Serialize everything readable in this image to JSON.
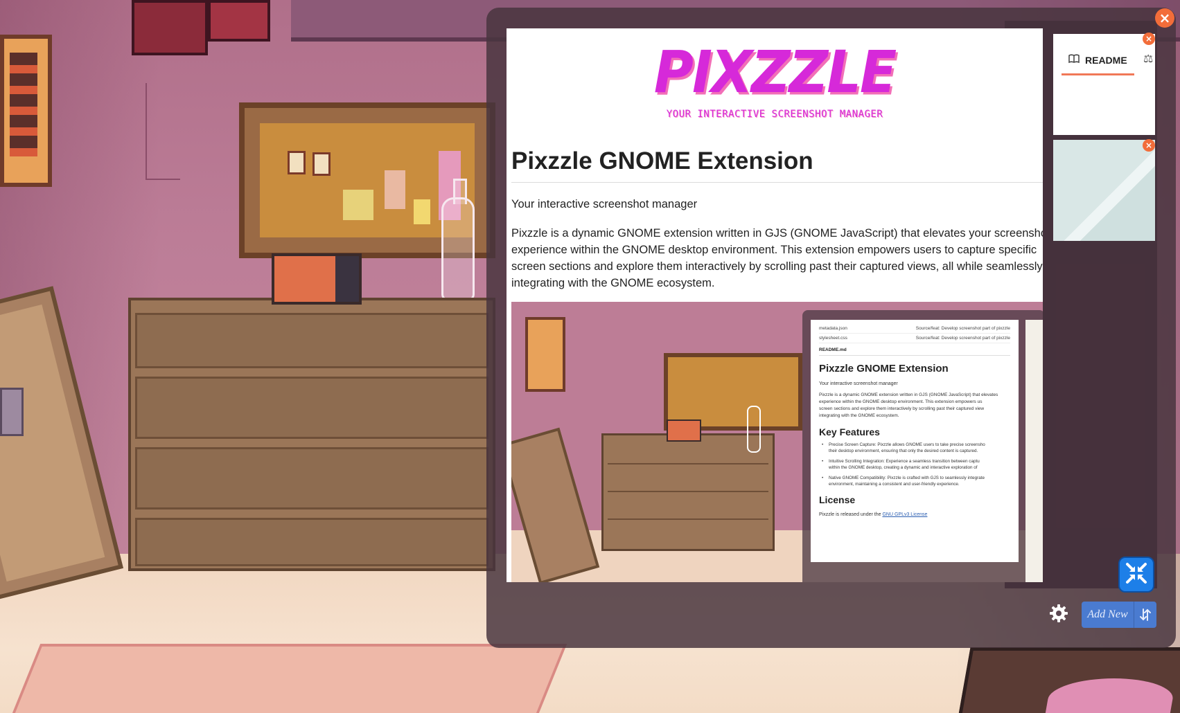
{
  "app": {
    "logo_title": "PIXZZLE",
    "logo_tagline": "YOUR INTERACTIVE SCREENSHOT MANAGER"
  },
  "readme": {
    "heading": "Pixzzle GNOME Extension",
    "subtitle": "Your interactive screenshot manager",
    "paragraph_lines": [
      "Pixzzle is a dynamic GNOME extension written in GJS (GNOME JavaScript) that elevates your screenshot",
      "experience within the GNOME desktop environment. This extension empowers users to capture specific",
      "screen sections and explore them interactively by scrolling past their captured views, all while seamlessly",
      "integrating with the GNOME ecosystem."
    ]
  },
  "nested_screenshot": {
    "files": [
      {
        "name": "metadata.json",
        "commit": "Source/feat: Develop screenshot part of pixzzle"
      },
      {
        "name": "stylesheet.css",
        "commit": "Source/feat: Develop screenshot part of pixzzle"
      }
    ],
    "readme_label": "README.md",
    "heading": "Pixzzle GNOME Extension",
    "subtitle": "Your interactive screenshot manager",
    "para_lines": [
      "Pixzzle is a dynamic GNOME extension written in GJS (GNOME JavaScript) that elevates",
      "experience within the GNOME desktop environment. This extension empowers us",
      "screen sections and explore them interactively by scrolling past their captured view",
      "integrating with the GNOME ecosystem."
    ],
    "features_heading": "Key Features",
    "features": [
      "Precise Screen Capture: Pixzzle allows GNOME users to take precise screensho",
      "Intuitive Scrolling Integration: Experience a seamless transition between captu",
      "Native GNOME Compatibility: Pixzzle is crafted with GJS to seamlessly integrate"
    ],
    "feature_cont": [
      "their desktop environment, ensuring that only the desired content is captured.",
      "within the GNOME desktop, creating a dynamic and interactive exploration of",
      "environment, maintaining a consistent and user-friendly experience."
    ],
    "license_heading": "License",
    "license_text": "Pixzzle is released under the",
    "license_link": "GNU GPLv3 License"
  },
  "thumbnails": [
    {
      "tab_label": "README",
      "tab_icon": "book-icon",
      "second_icon": "scale-icon"
    },
    {
      "kind": "image"
    }
  ],
  "controls": {
    "add_new_label": "Add New",
    "collapse_icon": "collapse-arrows-icon",
    "settings_icon": "gear-icon",
    "sort_icon": "sort-arrows-icon",
    "close_icon": "close-icon"
  },
  "colors": {
    "accent_close": "#f26d3a",
    "brand_pink": "#d629d9",
    "button_blue": "#4a7bd0",
    "collapse_blue": "#1d7fe8",
    "tab_underline": "#f07857"
  }
}
